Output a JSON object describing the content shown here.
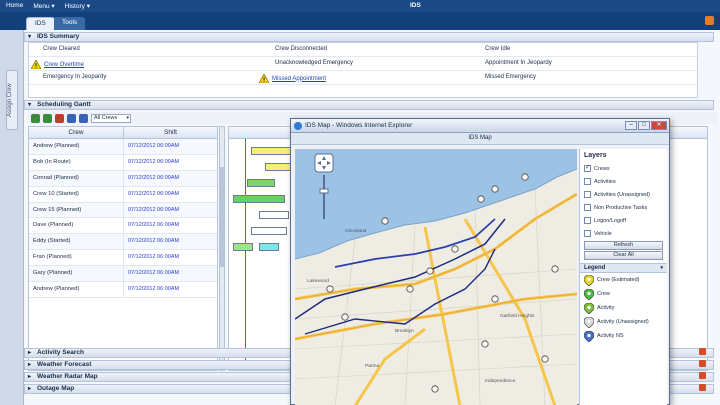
{
  "topbar": {
    "menu": [
      "Home",
      "Menu ▾",
      "History ▾"
    ],
    "title": "IDS"
  },
  "tabs": [
    "IDS",
    "Tools"
  ],
  "leftstrip": {
    "label": "Assign Crew"
  },
  "summary": {
    "header": "IDS Summary",
    "rows": [
      [
        "Crew Cleared",
        "Crew Disconnected",
        "Crew Idle"
      ],
      [
        "Crew Overtime",
        "Unacknowledged Emergency",
        "Appointment In Jeopardy"
      ],
      [
        "Emergency In Jeopardy",
        "Missed Appointment",
        "Missed Emergency"
      ]
    ]
  },
  "scheduling": {
    "header": "Scheduling Gantt",
    "select": "All Crews",
    "columns": [
      "Crew",
      "Shift"
    ],
    "rows": [
      [
        "Andrew (Planned)",
        "07/12/2012 06:00AM"
      ],
      [
        "Bob (In Route)",
        "07/12/2012 06:00AM"
      ],
      [
        "Conrad (Planned)",
        "07/12/2012 06:00AM"
      ],
      [
        "Crew 10 (Started)",
        "07/12/2012 06:00AM"
      ],
      [
        "Crew 15 (Planned)",
        "07/12/2012 06:00AM"
      ],
      [
        "Dave (Planned)",
        "07/12/2012 06:00AM"
      ],
      [
        "Eddy (Started)",
        "07/12/2012 06:00AM"
      ],
      [
        "Fran (Planned)",
        "07/12/2012 06:00AM"
      ],
      [
        "Gary (Planned)",
        "07/12/2012 06:00AM"
      ],
      [
        "Andrew (Planned)",
        "07/12/2012 06:00AM"
      ]
    ]
  },
  "bottom_sections": [
    "Activity Search",
    "Weather Forecast",
    "Weather Radar Map",
    "Outage Map"
  ],
  "popup": {
    "title": "IDS Map - Windows Internet Explorer",
    "subtitle": "IDS Map",
    "layers_title": "Layers",
    "layers": [
      {
        "label": "Crews",
        "checked": true
      },
      {
        "label": "Activities",
        "checked": false
      },
      {
        "label": "Activities (Unassigned)",
        "checked": false
      },
      {
        "label": "Non Productive Tasks",
        "checked": false
      },
      {
        "label": "Logon/Logoff",
        "checked": false
      },
      {
        "label": "Vehicle",
        "checked": false
      }
    ],
    "refresh_label": "Refresh",
    "clear_label": "Clear All",
    "legend_title": "Legend",
    "legend": [
      "Crew (Estimated)",
      "Crew",
      "Activity",
      "Activity (Unassigned)",
      "Activity NS"
    ],
    "map_labels": [
      "Cleveland",
      "Lakewood",
      "Parma",
      "Brooklyn",
      "Garfield Heights",
      "Independence"
    ]
  },
  "colors": {
    "topbar": "#1b4a86",
    "accent_blue": "#2443b4",
    "lake": "#9cc3e6",
    "highway": "#f6c64a"
  }
}
